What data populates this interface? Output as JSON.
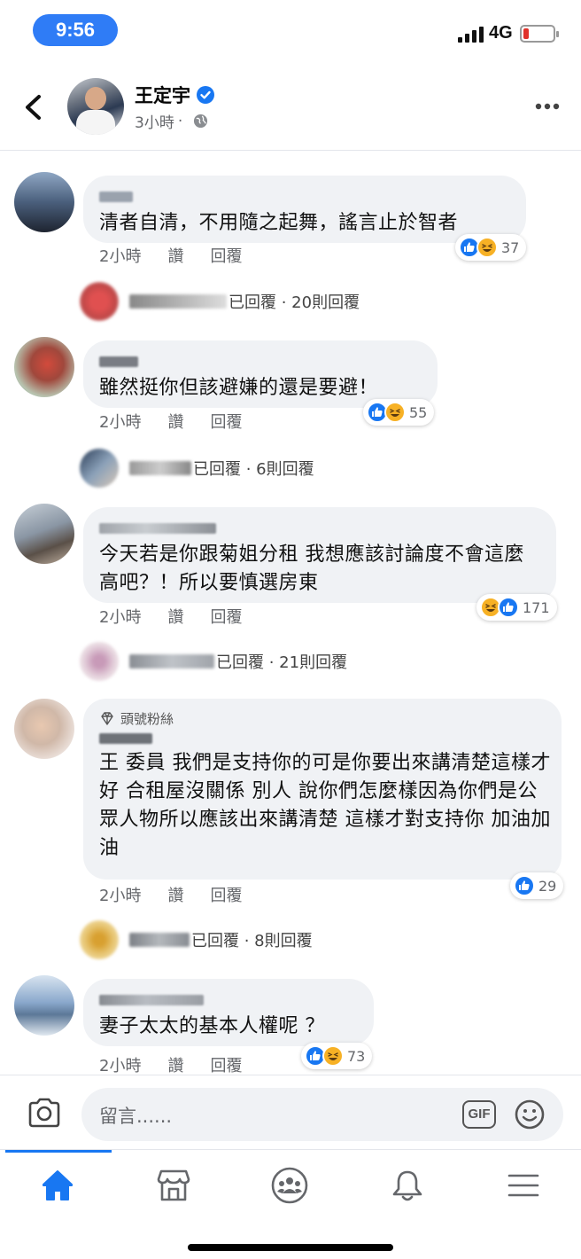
{
  "status_bar": {
    "time": "9:56",
    "network": "4G",
    "battery_level": 0.18,
    "battery_color": "#e0322b",
    "time_pill_color": "#2f7cf6"
  },
  "header": {
    "author_name": "王定宇",
    "time_ago": "3小時",
    "separator": "·",
    "icons": [
      "back-icon",
      "verified-icon",
      "globe-icon",
      "more-icon"
    ]
  },
  "comments": [
    {
      "text": "清者自清，不用隨之起舞，謠言止於智者",
      "time": "2小時",
      "like_label": "讚",
      "reply_label": "回覆",
      "reactions": [
        "like",
        "haha"
      ],
      "reaction_count": "37",
      "replies_text": "已回覆 · 20則回覆",
      "fan_badge": ""
    },
    {
      "text": "雖然挺你但該避嫌的還是要避！",
      "time": "2小時",
      "like_label": "讚",
      "reply_label": "回覆",
      "reactions": [
        "like",
        "haha"
      ],
      "reaction_count": "55",
      "replies_text": "已回覆 · 6則回覆",
      "fan_badge": ""
    },
    {
      "text": "今天若是你跟菊姐分租 我想應該討論度不會這麼高吧？！所以要慎選房東",
      "time": "2小時",
      "like_label": "讚",
      "reply_label": "回覆",
      "reactions": [
        "haha",
        "like"
      ],
      "reaction_count": "171",
      "replies_text": "已回覆 · 21則回覆",
      "fan_badge": ""
    },
    {
      "text": "王 委員 我們是支持你的可是你要出來講清楚這樣才好 合租屋沒關係 別人 說你們怎麼樣因為你們是公眾人物所以應該出來講清楚 這樣才對支持你 加油加油",
      "time": "2小時",
      "like_label": "讚",
      "reply_label": "回覆",
      "reactions": [
        "like"
      ],
      "reaction_count": "29",
      "replies_text": "已回覆 · 8則回覆",
      "fan_badge": "頭號粉絲"
    },
    {
      "text": "妻子太太的基本人權呢 ？",
      "time": "2小時",
      "like_label": "讚",
      "reply_label": "回覆",
      "reactions": [
        "like",
        "haha"
      ],
      "reaction_count": "73",
      "replies_text": "",
      "fan_badge": ""
    }
  ],
  "composer": {
    "placeholder": "留言......",
    "gif_label": "GIF"
  },
  "tabs": [
    {
      "name": "home-icon",
      "active": true
    },
    {
      "name": "marketplace-icon",
      "active": false
    },
    {
      "name": "groups-icon",
      "active": false
    },
    {
      "name": "notifications-icon",
      "active": false
    },
    {
      "name": "menu-icon",
      "active": false
    }
  ],
  "colors": {
    "accent": "#1877f2",
    "bubble": "#f0f2f5",
    "muted_text": "#65676b",
    "haha": "#f7b125"
  }
}
